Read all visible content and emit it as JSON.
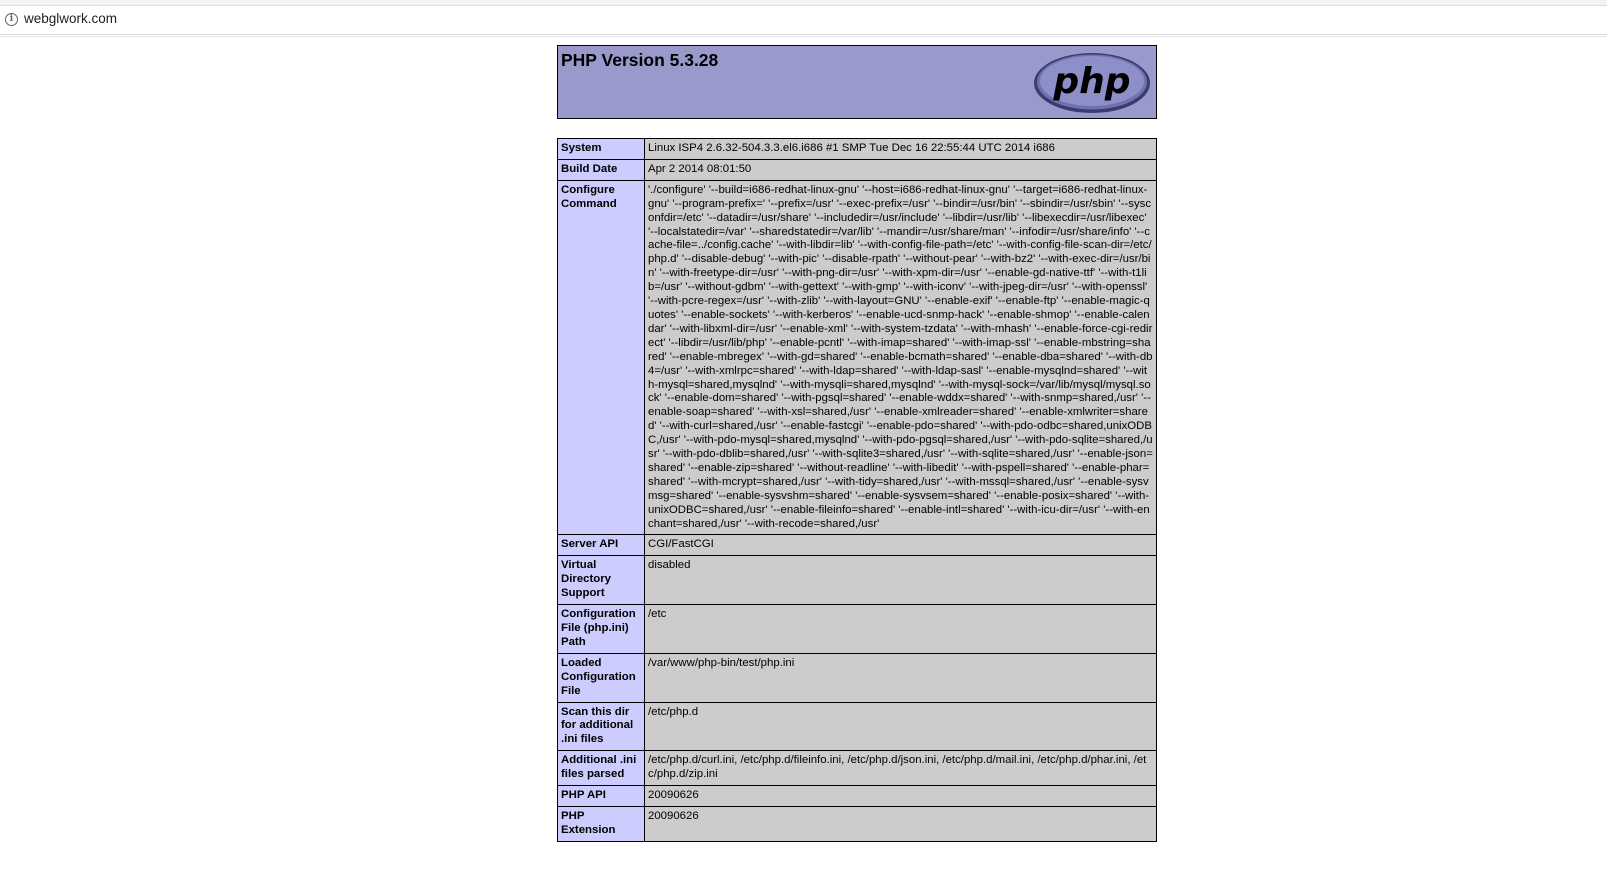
{
  "browser": {
    "url": "webglwork.com",
    "info_icon": "info-icon"
  },
  "header": {
    "title": "PHP Version 5.3.28",
    "logo_text": "php"
  },
  "rows": [
    {
      "label": "System",
      "value": "Linux ISP4 2.6.32-504.3.3.el6.i686 #1 SMP Tue Dec 16 22:55:44 UTC 2014 i686"
    },
    {
      "label": "Build Date",
      "value": "Apr 2 2014 08:01:50"
    },
    {
      "label": "Configure Command",
      "value": "'./configure' '--build=i686-redhat-linux-gnu' '--host=i686-redhat-linux-gnu' '--target=i686-redhat-linux-gnu' '--program-prefix=' '--prefix=/usr' '--exec-prefix=/usr' '--bindir=/usr/bin' '--sbindir=/usr/sbin' '--sysconfdir=/etc' '--datadir=/usr/share' '--includedir=/usr/include' '--libdir=/usr/lib' '--libexecdir=/usr/libexec' '--localstatedir=/var' '--sharedstatedir=/var/lib' '--mandir=/usr/share/man' '--infodir=/usr/share/info' '--cache-file=../config.cache' '--with-libdir=lib' '--with-config-file-path=/etc' '--with-config-file-scan-dir=/etc/php.d' '--disable-debug' '--with-pic' '--disable-rpath' '--without-pear' '--with-bz2' '--with-exec-dir=/usr/bin' '--with-freetype-dir=/usr' '--with-png-dir=/usr' '--with-xpm-dir=/usr' '--enable-gd-native-ttf' '--with-t1lib=/usr' '--without-gdbm' '--with-gettext' '--with-gmp' '--with-iconv' '--with-jpeg-dir=/usr' '--with-openssl' '--with-pcre-regex=/usr' '--with-zlib' '--with-layout=GNU' '--enable-exif' '--enable-ftp' '--enable-magic-quotes' '--enable-sockets' '--with-kerberos' '--enable-ucd-snmp-hack' '--enable-shmop' '--enable-calendar' '--with-libxml-dir=/usr' '--enable-xml' '--with-system-tzdata' '--with-mhash' '--enable-force-cgi-redirect' '--libdir=/usr/lib/php' '--enable-pcntl' '--with-imap=shared' '--with-imap-ssl' '--enable-mbstring=shared' '--enable-mbregex' '--with-gd=shared' '--enable-bcmath=shared' '--enable-dba=shared' '--with-db4=/usr' '--with-xmlrpc=shared' '--with-ldap=shared' '--with-ldap-sasl' '--enable-mysqlnd=shared' '--with-mysql=shared,mysqlnd' '--with-mysqli=shared,mysqlnd' '--with-mysql-sock=/var/lib/mysql/mysql.sock' '--enable-dom=shared' '--with-pgsql=shared' '--enable-wddx=shared' '--with-snmp=shared,/usr' '--enable-soap=shared' '--with-xsl=shared,/usr' '--enable-xmlreader=shared' '--enable-xmlwriter=shared' '--with-curl=shared,/usr' '--enable-fastcgi' '--enable-pdo=shared' '--with-pdo-odbc=shared,unixODBC,/usr' '--with-pdo-mysql=shared,mysqlnd' '--with-pdo-pgsql=shared,/usr' '--with-pdo-sqlite=shared,/usr' '--with-pdo-dblib=shared,/usr' '--with-sqlite3=shared,/usr' '--with-sqlite=shared,/usr' '--enable-json=shared' '--enable-zip=shared' '--without-readline' '--with-libedit' '--with-pspell=shared' '--enable-phar=shared' '--with-mcrypt=shared,/usr' '--with-tidy=shared,/usr' '--with-mssql=shared,/usr' '--enable-sysvmsg=shared' '--enable-sysvshm=shared' '--enable-sysvsem=shared' '--enable-posix=shared' '--with-unixODBC=shared,/usr' '--enable-fileinfo=shared' '--enable-intl=shared' '--with-icu-dir=/usr' '--with-enchant=shared,/usr' '--with-recode=shared,/usr'"
    },
    {
      "label": "Server API",
      "value": "CGI/FastCGI"
    },
    {
      "label": "Virtual Directory Support",
      "value": "disabled"
    },
    {
      "label": "Configuration File (php.ini) Path",
      "value": "/etc"
    },
    {
      "label": "Loaded Configuration File",
      "value": "/var/www/php-bin/test/php.ini"
    },
    {
      "label": "Scan this dir for additional .ini files",
      "value": "/etc/php.d"
    },
    {
      "label": "Additional .ini files parsed",
      "value": "/etc/php.d/curl.ini, /etc/php.d/fileinfo.ini, /etc/php.d/json.ini, /etc/php.d/mail.ini, /etc/php.d/phar.ini, /etc/php.d/zip.ini"
    },
    {
      "label": "PHP API",
      "value": "20090626"
    },
    {
      "label": "PHP Extension",
      "value": "20090626"
    }
  ]
}
